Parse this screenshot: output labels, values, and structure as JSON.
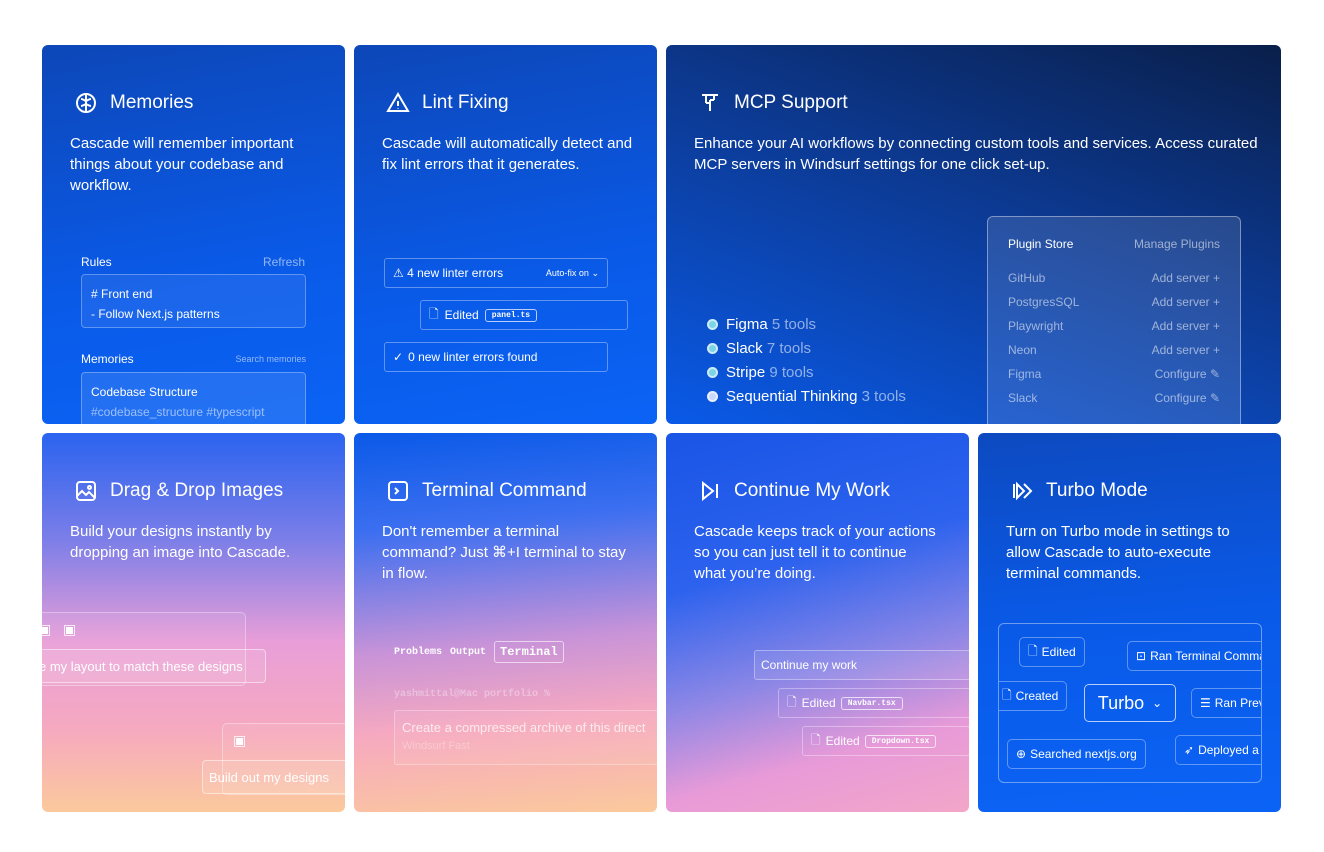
{
  "memories": {
    "title": "Memories",
    "desc": "Cascade will remember important things about your codebase and workflow.",
    "rules_label": "Rules",
    "refresh_label": "Refresh",
    "rule_line1": "# Front end",
    "rule_line2": "- Follow Next.js patterns",
    "memories_label": "Memories",
    "search_label": "Search memories",
    "memory_title": "Codebase Structure",
    "memory_tags": "#codebase_structure #typescript"
  },
  "lint": {
    "title": "Lint Fixing",
    "desc": "Cascade will automatically detect and fix lint errors that it generates.",
    "errors_label": "4 new linter errors",
    "autofix_label": "Auto-fix on",
    "edited_label": "Edited",
    "edited_file": "panel.ts",
    "found_label": "0 new linter errors found"
  },
  "mcp": {
    "title": "MCP Support",
    "desc": "Enhance your AI workflows by connecting custom tools and services. Access curated MCP servers in Windsurf settings for one click set-up.",
    "tools": [
      {
        "name": "Figma",
        "count": "5 tools"
      },
      {
        "name": "Slack",
        "count": "7 tools"
      },
      {
        "name": "Stripe",
        "count": "9 tools"
      },
      {
        "name": "Sequential Thinking",
        "count": "3 tools"
      }
    ],
    "store_title": "Plugin Store",
    "manage_label": "Manage Plugins",
    "plugins": [
      {
        "name": "GitHub",
        "action": "Add server +"
      },
      {
        "name": "PostgresSQL",
        "action": "Add server +"
      },
      {
        "name": "Playwright",
        "action": "Add server +"
      },
      {
        "name": "Neon",
        "action": "Add server +"
      },
      {
        "name": "Figma",
        "action": "Configure"
      },
      {
        "name": "Slack",
        "action": "Configure"
      }
    ]
  },
  "drag": {
    "title": "Drag & Drop Images",
    "desc": "Build your designs instantly by dropping an image into Cascade.",
    "prompt1": "e my layout to match these designs",
    "prompt2": "Build out my designs"
  },
  "terminal": {
    "title": "Terminal Command",
    "desc": "Don't remember a terminal command? Just ⌘+I terminal to stay in flow.",
    "tab_problems": "Problems",
    "tab_output": "Output",
    "tab_terminal": "Terminal",
    "prompt_line": "yashmittal@Mac portfolio %",
    "input_text": "Create a compressed archive of this direct",
    "model_label": "Windsurf Fast"
  },
  "continue": {
    "title": "Continue My Work",
    "desc": "Cascade keeps track of your actions so you can just tell it to continue what you’re doing.",
    "continue_label": "Continue my work",
    "edited_label": "Edited",
    "file1": "Navbar.tsx",
    "file2": "Dropdown.tsx"
  },
  "turbo": {
    "title": "Turbo Mode",
    "desc": "Turn on Turbo mode in settings to allow Cascade to auto-execute terminal commands.",
    "chip_edited": "Edited",
    "chip_ran_terminal": "Ran Terminal Comma",
    "chip_created": "Created",
    "turbo_label": "Turbo",
    "chip_ran_preview": "Ran Prev",
    "chip_searched": "Searched nextjs.org",
    "chip_deployed": "Deployed a"
  }
}
